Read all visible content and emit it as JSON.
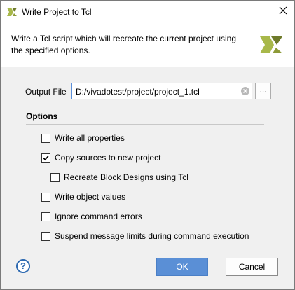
{
  "window": {
    "title": "Write Project to Tcl",
    "close_icon": "close-icon",
    "logo_icon": "vivado-logo-icon"
  },
  "header": {
    "description": "Write a Tcl script which will recreate the current project using the specified options."
  },
  "output_file": {
    "label": "Output File",
    "value": "D:/vivadotest/project/project_1.tcl",
    "browse_label": "...",
    "clear_icon": "clear-icon"
  },
  "options": {
    "title": "Options",
    "items": [
      {
        "label": "Write all properties",
        "checked": false
      },
      {
        "label": "Copy sources to new project",
        "checked": true
      },
      {
        "label": "Recreate Block Designs using Tcl",
        "checked": false
      },
      {
        "label": "Write object values",
        "checked": false
      },
      {
        "label": "Ignore command errors",
        "checked": false
      },
      {
        "label": "Suspend message limits during command execution",
        "checked": false
      }
    ]
  },
  "footer": {
    "help_label": "?",
    "ok_label": "OK",
    "cancel_label": "Cancel"
  },
  "colors": {
    "accent": "#5a8fd6",
    "logo_green": "#a8b84a",
    "logo_dark": "#6e7a2a"
  }
}
